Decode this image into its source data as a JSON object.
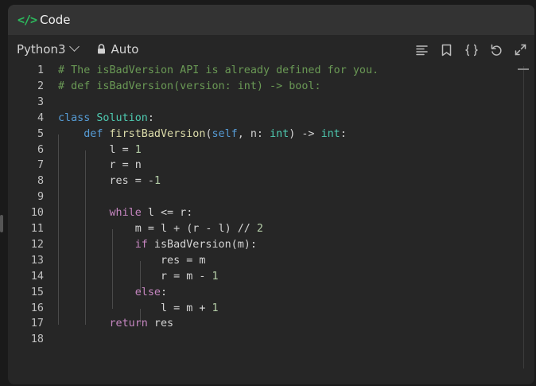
{
  "panel": {
    "title": "Code",
    "title_icon": "code-brackets-icon"
  },
  "toolbar": {
    "language": "Python3",
    "mode": "Auto",
    "tools": [
      "format-icon",
      "bookmark-icon",
      "braces-icon",
      "reset-icon",
      "expand-icon"
    ]
  },
  "colors": {
    "accent": "#2cbb5d",
    "background": "#262626",
    "titlebar": "#333333"
  },
  "editor": {
    "line_numbers": [
      "1",
      "2",
      "3",
      "4",
      "5",
      "6",
      "7",
      "8",
      "9",
      "10",
      "11",
      "12",
      "13",
      "14",
      "15",
      "16",
      "17",
      "18"
    ],
    "lines": [
      "# The isBadVersion API is already defined for you.",
      "# def isBadVersion(version: int) -> bool:",
      "",
      "class Solution:",
      "    def firstBadVersion(self, n: int) -> int:",
      "        l = 1",
      "        r = n",
      "        res = -1",
      "",
      "        while l <= r:",
      "            m = l + (r - l) // 2",
      "            if isBadVersion(m):",
      "                res = m",
      "                r = m - 1",
      "            else:",
      "                l = m + 1",
      "        return res",
      ""
    ]
  }
}
